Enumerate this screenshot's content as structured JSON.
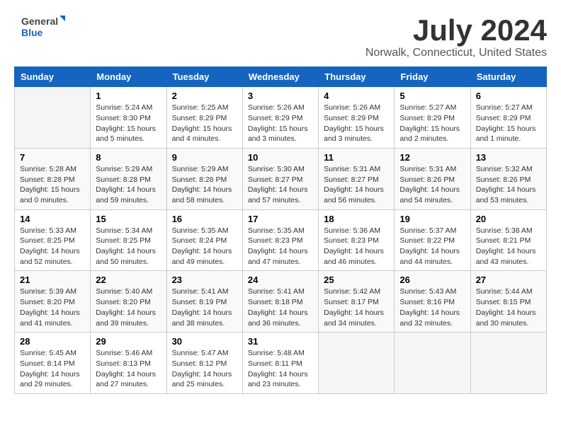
{
  "logo": {
    "general": "General",
    "blue": "Blue"
  },
  "title": "July 2024",
  "subtitle": "Norwalk, Connecticut, United States",
  "days_header": [
    "Sunday",
    "Monday",
    "Tuesday",
    "Wednesday",
    "Thursday",
    "Friday",
    "Saturday"
  ],
  "weeks": [
    [
      {
        "day": "",
        "info": ""
      },
      {
        "day": "1",
        "info": "Sunrise: 5:24 AM\nSunset: 8:30 PM\nDaylight: 15 hours\nand 5 minutes."
      },
      {
        "day": "2",
        "info": "Sunrise: 5:25 AM\nSunset: 8:29 PM\nDaylight: 15 hours\nand 4 minutes."
      },
      {
        "day": "3",
        "info": "Sunrise: 5:26 AM\nSunset: 8:29 PM\nDaylight: 15 hours\nand 3 minutes."
      },
      {
        "day": "4",
        "info": "Sunrise: 5:26 AM\nSunset: 8:29 PM\nDaylight: 15 hours\nand 3 minutes."
      },
      {
        "day": "5",
        "info": "Sunrise: 5:27 AM\nSunset: 8:29 PM\nDaylight: 15 hours\nand 2 minutes."
      },
      {
        "day": "6",
        "info": "Sunrise: 5:27 AM\nSunset: 8:29 PM\nDaylight: 15 hours\nand 1 minute."
      }
    ],
    [
      {
        "day": "7",
        "info": "Sunrise: 5:28 AM\nSunset: 8:28 PM\nDaylight: 15 hours\nand 0 minutes."
      },
      {
        "day": "8",
        "info": "Sunrise: 5:29 AM\nSunset: 8:28 PM\nDaylight: 14 hours\nand 59 minutes."
      },
      {
        "day": "9",
        "info": "Sunrise: 5:29 AM\nSunset: 8:28 PM\nDaylight: 14 hours\nand 58 minutes."
      },
      {
        "day": "10",
        "info": "Sunrise: 5:30 AM\nSunset: 8:27 PM\nDaylight: 14 hours\nand 57 minutes."
      },
      {
        "day": "11",
        "info": "Sunrise: 5:31 AM\nSunset: 8:27 PM\nDaylight: 14 hours\nand 56 minutes."
      },
      {
        "day": "12",
        "info": "Sunrise: 5:31 AM\nSunset: 8:26 PM\nDaylight: 14 hours\nand 54 minutes."
      },
      {
        "day": "13",
        "info": "Sunrise: 5:32 AM\nSunset: 8:26 PM\nDaylight: 14 hours\nand 53 minutes."
      }
    ],
    [
      {
        "day": "14",
        "info": "Sunrise: 5:33 AM\nSunset: 8:25 PM\nDaylight: 14 hours\nand 52 minutes."
      },
      {
        "day": "15",
        "info": "Sunrise: 5:34 AM\nSunset: 8:25 PM\nDaylight: 14 hours\nand 50 minutes."
      },
      {
        "day": "16",
        "info": "Sunrise: 5:35 AM\nSunset: 8:24 PM\nDaylight: 14 hours\nand 49 minutes."
      },
      {
        "day": "17",
        "info": "Sunrise: 5:35 AM\nSunset: 8:23 PM\nDaylight: 14 hours\nand 47 minutes."
      },
      {
        "day": "18",
        "info": "Sunrise: 5:36 AM\nSunset: 8:23 PM\nDaylight: 14 hours\nand 46 minutes."
      },
      {
        "day": "19",
        "info": "Sunrise: 5:37 AM\nSunset: 8:22 PM\nDaylight: 14 hours\nand 44 minutes."
      },
      {
        "day": "20",
        "info": "Sunrise: 5:38 AM\nSunset: 8:21 PM\nDaylight: 14 hours\nand 43 minutes."
      }
    ],
    [
      {
        "day": "21",
        "info": "Sunrise: 5:39 AM\nSunset: 8:20 PM\nDaylight: 14 hours\nand 41 minutes."
      },
      {
        "day": "22",
        "info": "Sunrise: 5:40 AM\nSunset: 8:20 PM\nDaylight: 14 hours\nand 39 minutes."
      },
      {
        "day": "23",
        "info": "Sunrise: 5:41 AM\nSunset: 8:19 PM\nDaylight: 14 hours\nand 38 minutes."
      },
      {
        "day": "24",
        "info": "Sunrise: 5:41 AM\nSunset: 8:18 PM\nDaylight: 14 hours\nand 36 minutes."
      },
      {
        "day": "25",
        "info": "Sunrise: 5:42 AM\nSunset: 8:17 PM\nDaylight: 14 hours\nand 34 minutes."
      },
      {
        "day": "26",
        "info": "Sunrise: 5:43 AM\nSunset: 8:16 PM\nDaylight: 14 hours\nand 32 minutes."
      },
      {
        "day": "27",
        "info": "Sunrise: 5:44 AM\nSunset: 8:15 PM\nDaylight: 14 hours\nand 30 minutes."
      }
    ],
    [
      {
        "day": "28",
        "info": "Sunrise: 5:45 AM\nSunset: 8:14 PM\nDaylight: 14 hours\nand 29 minutes."
      },
      {
        "day": "29",
        "info": "Sunrise: 5:46 AM\nSunset: 8:13 PM\nDaylight: 14 hours\nand 27 minutes."
      },
      {
        "day": "30",
        "info": "Sunrise: 5:47 AM\nSunset: 8:12 PM\nDaylight: 14 hours\nand 25 minutes."
      },
      {
        "day": "31",
        "info": "Sunrise: 5:48 AM\nSunset: 8:11 PM\nDaylight: 14 hours\nand 23 minutes."
      },
      {
        "day": "",
        "info": ""
      },
      {
        "day": "",
        "info": ""
      },
      {
        "day": "",
        "info": ""
      }
    ]
  ]
}
